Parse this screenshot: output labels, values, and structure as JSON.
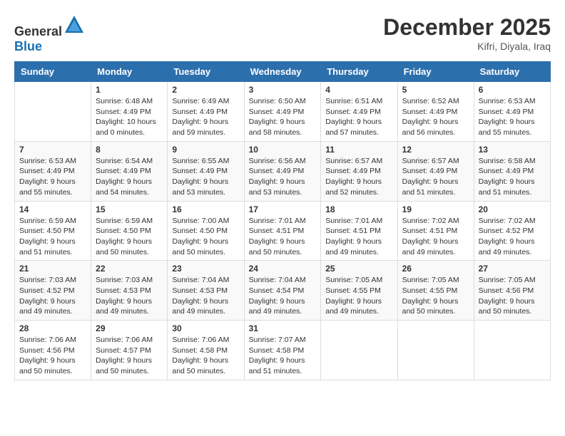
{
  "header": {
    "logo_general": "General",
    "logo_blue": "Blue",
    "month": "December 2025",
    "location": "Kifri, Diyala, Iraq"
  },
  "columns": [
    "Sunday",
    "Monday",
    "Tuesday",
    "Wednesday",
    "Thursday",
    "Friday",
    "Saturday"
  ],
  "weeks": [
    [
      {
        "day": "",
        "sunrise": "",
        "sunset": "",
        "daylight": ""
      },
      {
        "day": "1",
        "sunrise": "Sunrise: 6:48 AM",
        "sunset": "Sunset: 4:49 PM",
        "daylight": "Daylight: 10 hours and 0 minutes."
      },
      {
        "day": "2",
        "sunrise": "Sunrise: 6:49 AM",
        "sunset": "Sunset: 4:49 PM",
        "daylight": "Daylight: 9 hours and 59 minutes."
      },
      {
        "day": "3",
        "sunrise": "Sunrise: 6:50 AM",
        "sunset": "Sunset: 4:49 PM",
        "daylight": "Daylight: 9 hours and 58 minutes."
      },
      {
        "day": "4",
        "sunrise": "Sunrise: 6:51 AM",
        "sunset": "Sunset: 4:49 PM",
        "daylight": "Daylight: 9 hours and 57 minutes."
      },
      {
        "day": "5",
        "sunrise": "Sunrise: 6:52 AM",
        "sunset": "Sunset: 4:49 PM",
        "daylight": "Daylight: 9 hours and 56 minutes."
      },
      {
        "day": "6",
        "sunrise": "Sunrise: 6:53 AM",
        "sunset": "Sunset: 4:49 PM",
        "daylight": "Daylight: 9 hours and 55 minutes."
      }
    ],
    [
      {
        "day": "7",
        "sunrise": "Sunrise: 6:53 AM",
        "sunset": "Sunset: 4:49 PM",
        "daylight": "Daylight: 9 hours and 55 minutes."
      },
      {
        "day": "8",
        "sunrise": "Sunrise: 6:54 AM",
        "sunset": "Sunset: 4:49 PM",
        "daylight": "Daylight: 9 hours and 54 minutes."
      },
      {
        "day": "9",
        "sunrise": "Sunrise: 6:55 AM",
        "sunset": "Sunset: 4:49 PM",
        "daylight": "Daylight: 9 hours and 53 minutes."
      },
      {
        "day": "10",
        "sunrise": "Sunrise: 6:56 AM",
        "sunset": "Sunset: 4:49 PM",
        "daylight": "Daylight: 9 hours and 53 minutes."
      },
      {
        "day": "11",
        "sunrise": "Sunrise: 6:57 AM",
        "sunset": "Sunset: 4:49 PM",
        "daylight": "Daylight: 9 hours and 52 minutes."
      },
      {
        "day": "12",
        "sunrise": "Sunrise: 6:57 AM",
        "sunset": "Sunset: 4:49 PM",
        "daylight": "Daylight: 9 hours and 51 minutes."
      },
      {
        "day": "13",
        "sunrise": "Sunrise: 6:58 AM",
        "sunset": "Sunset: 4:49 PM",
        "daylight": "Daylight: 9 hours and 51 minutes."
      }
    ],
    [
      {
        "day": "14",
        "sunrise": "Sunrise: 6:59 AM",
        "sunset": "Sunset: 4:50 PM",
        "daylight": "Daylight: 9 hours and 51 minutes."
      },
      {
        "day": "15",
        "sunrise": "Sunrise: 6:59 AM",
        "sunset": "Sunset: 4:50 PM",
        "daylight": "Daylight: 9 hours and 50 minutes."
      },
      {
        "day": "16",
        "sunrise": "Sunrise: 7:00 AM",
        "sunset": "Sunset: 4:50 PM",
        "daylight": "Daylight: 9 hours and 50 minutes."
      },
      {
        "day": "17",
        "sunrise": "Sunrise: 7:01 AM",
        "sunset": "Sunset: 4:51 PM",
        "daylight": "Daylight: 9 hours and 50 minutes."
      },
      {
        "day": "18",
        "sunrise": "Sunrise: 7:01 AM",
        "sunset": "Sunset: 4:51 PM",
        "daylight": "Daylight: 9 hours and 49 minutes."
      },
      {
        "day": "19",
        "sunrise": "Sunrise: 7:02 AM",
        "sunset": "Sunset: 4:51 PM",
        "daylight": "Daylight: 9 hours and 49 minutes."
      },
      {
        "day": "20",
        "sunrise": "Sunrise: 7:02 AM",
        "sunset": "Sunset: 4:52 PM",
        "daylight": "Daylight: 9 hours and 49 minutes."
      }
    ],
    [
      {
        "day": "21",
        "sunrise": "Sunrise: 7:03 AM",
        "sunset": "Sunset: 4:52 PM",
        "daylight": "Daylight: 9 hours and 49 minutes."
      },
      {
        "day": "22",
        "sunrise": "Sunrise: 7:03 AM",
        "sunset": "Sunset: 4:53 PM",
        "daylight": "Daylight: 9 hours and 49 minutes."
      },
      {
        "day": "23",
        "sunrise": "Sunrise: 7:04 AM",
        "sunset": "Sunset: 4:53 PM",
        "daylight": "Daylight: 9 hours and 49 minutes."
      },
      {
        "day": "24",
        "sunrise": "Sunrise: 7:04 AM",
        "sunset": "Sunset: 4:54 PM",
        "daylight": "Daylight: 9 hours and 49 minutes."
      },
      {
        "day": "25",
        "sunrise": "Sunrise: 7:05 AM",
        "sunset": "Sunset: 4:55 PM",
        "daylight": "Daylight: 9 hours and 49 minutes."
      },
      {
        "day": "26",
        "sunrise": "Sunrise: 7:05 AM",
        "sunset": "Sunset: 4:55 PM",
        "daylight": "Daylight: 9 hours and 50 minutes."
      },
      {
        "day": "27",
        "sunrise": "Sunrise: 7:05 AM",
        "sunset": "Sunset: 4:56 PM",
        "daylight": "Daylight: 9 hours and 50 minutes."
      }
    ],
    [
      {
        "day": "28",
        "sunrise": "Sunrise: 7:06 AM",
        "sunset": "Sunset: 4:56 PM",
        "daylight": "Daylight: 9 hours and 50 minutes."
      },
      {
        "day": "29",
        "sunrise": "Sunrise: 7:06 AM",
        "sunset": "Sunset: 4:57 PM",
        "daylight": "Daylight: 9 hours and 50 minutes."
      },
      {
        "day": "30",
        "sunrise": "Sunrise: 7:06 AM",
        "sunset": "Sunset: 4:58 PM",
        "daylight": "Daylight: 9 hours and 50 minutes."
      },
      {
        "day": "31",
        "sunrise": "Sunrise: 7:07 AM",
        "sunset": "Sunset: 4:58 PM",
        "daylight": "Daylight: 9 hours and 51 minutes."
      },
      {
        "day": "",
        "sunrise": "",
        "sunset": "",
        "daylight": ""
      },
      {
        "day": "",
        "sunrise": "",
        "sunset": "",
        "daylight": ""
      },
      {
        "day": "",
        "sunrise": "",
        "sunset": "",
        "daylight": ""
      }
    ]
  ]
}
